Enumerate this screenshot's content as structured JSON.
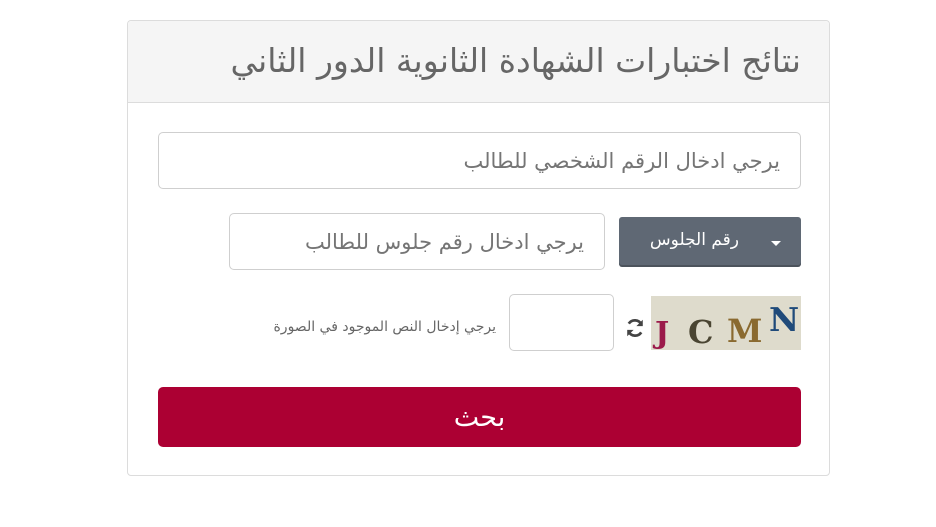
{
  "panel": {
    "title": "نتائج اختبارات الشهادة الثانوية الدور الثاني"
  },
  "form": {
    "personal_id": {
      "placeholder": "يرجي ادخال الرقم الشخصي للطالب",
      "value": ""
    },
    "seat_number": {
      "placeholder": "يرجي ادخال رقم جلوس للطالب",
      "value": ""
    },
    "search_type": {
      "selected": "رقم الجلوس"
    },
    "captcha": {
      "label": "يرجي إدخال النص الموجود في الصورة",
      "value": "",
      "characters": [
        {
          "char": "J",
          "color": "#9b1a4a"
        },
        {
          "char": "C",
          "color": "#4a4532"
        },
        {
          "char": "M",
          "color": "#8a6a30"
        },
        {
          "char": "N",
          "color": "#1f4a7a"
        }
      ]
    },
    "submit_label": "بحث"
  },
  "colors": {
    "submit": "#ac0033",
    "dropdown": "#5f6874",
    "heading_bg": "#f5f5f5"
  }
}
